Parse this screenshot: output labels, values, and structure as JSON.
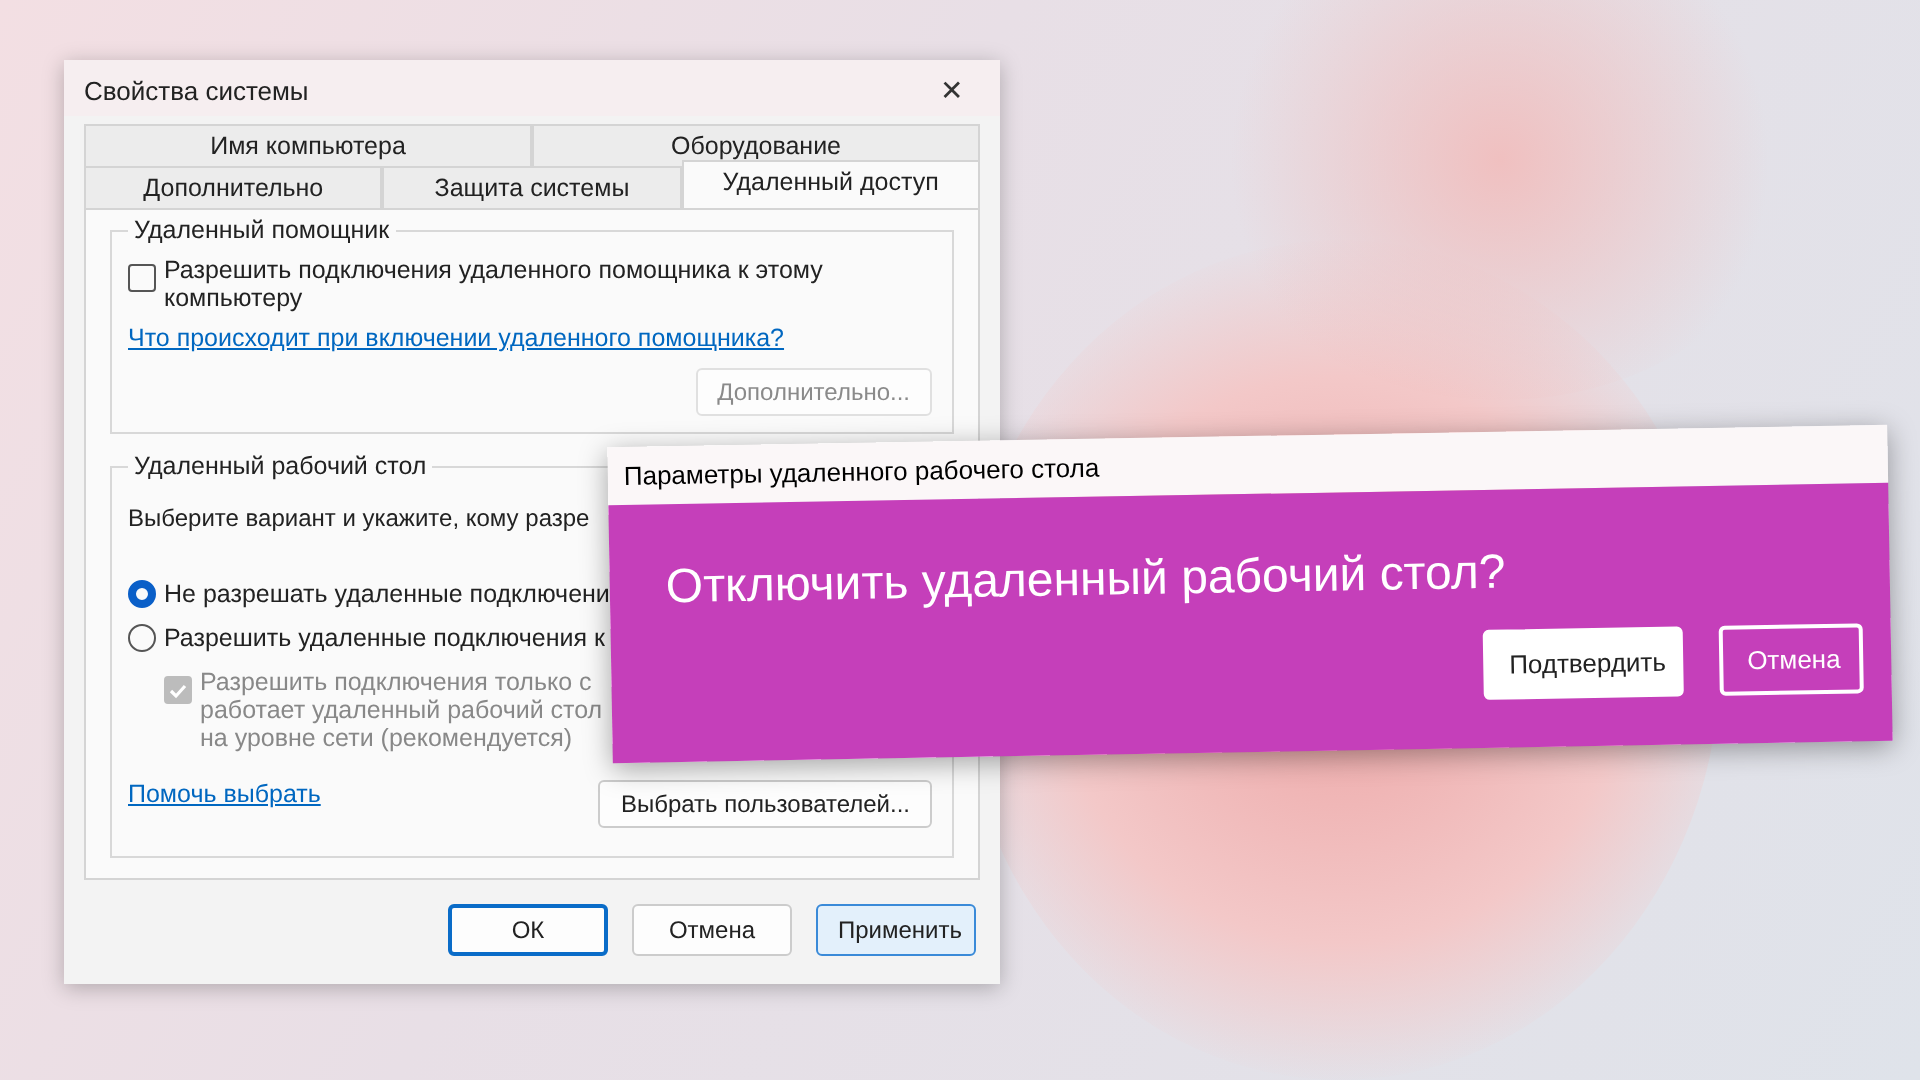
{
  "system_properties": {
    "title": "Свойства системы",
    "close": "✕",
    "tab_rows": [
      [
        {
          "label": "Имя компьютера",
          "selected": false
        },
        {
          "label": "Оборудование",
          "selected": false
        }
      ],
      [
        {
          "label": "Дополнительно",
          "selected": false
        },
        {
          "label": "Защита системы",
          "selected": false
        },
        {
          "label": "Удаленный доступ",
          "selected": true
        }
      ]
    ],
    "remote_assistance": {
      "legend": "Удаленный помощник",
      "checkbox": {
        "label": "Разрешить подключения удаленного помощника к этому компьютеру",
        "checked": false
      },
      "link": "Что происходит при включении удаленного помощника?",
      "button": {
        "label": "Дополнительно...",
        "disabled": true
      }
    },
    "remote_desktop": {
      "legend": "Удаленный рабочий стол",
      "intro": "Выберите вариант и укажите, кому разре",
      "options": [
        {
          "label": "Не разрешать удаленные подключени",
          "selected": true
        },
        {
          "label": "Разрешить удаленные подключения к",
          "selected": false
        }
      ],
      "nla_checkbox": {
        "lines": [
          "Разрешить подключения только с",
          "работает удаленный рабочий стол",
          "на уровне сети (рекомендуется)"
        ],
        "checked": true,
        "disabled": true
      },
      "help_link": "Помочь выбрать",
      "select_users_button": "Выбрать пользователей..."
    },
    "buttons": [
      {
        "label": "ОК",
        "kind": "default"
      },
      {
        "label": "Отмена",
        "kind": "normal"
      },
      {
        "label": "Применить",
        "kind": "hover"
      }
    ]
  },
  "confirm_dialog": {
    "title": "Параметры удаленного рабочего стола",
    "message": "Отключить удаленный рабочий стол?",
    "buttons": [
      {
        "label": "Подтвердить",
        "kind": "primary"
      },
      {
        "label": "Отмена",
        "kind": "outline"
      }
    ]
  }
}
